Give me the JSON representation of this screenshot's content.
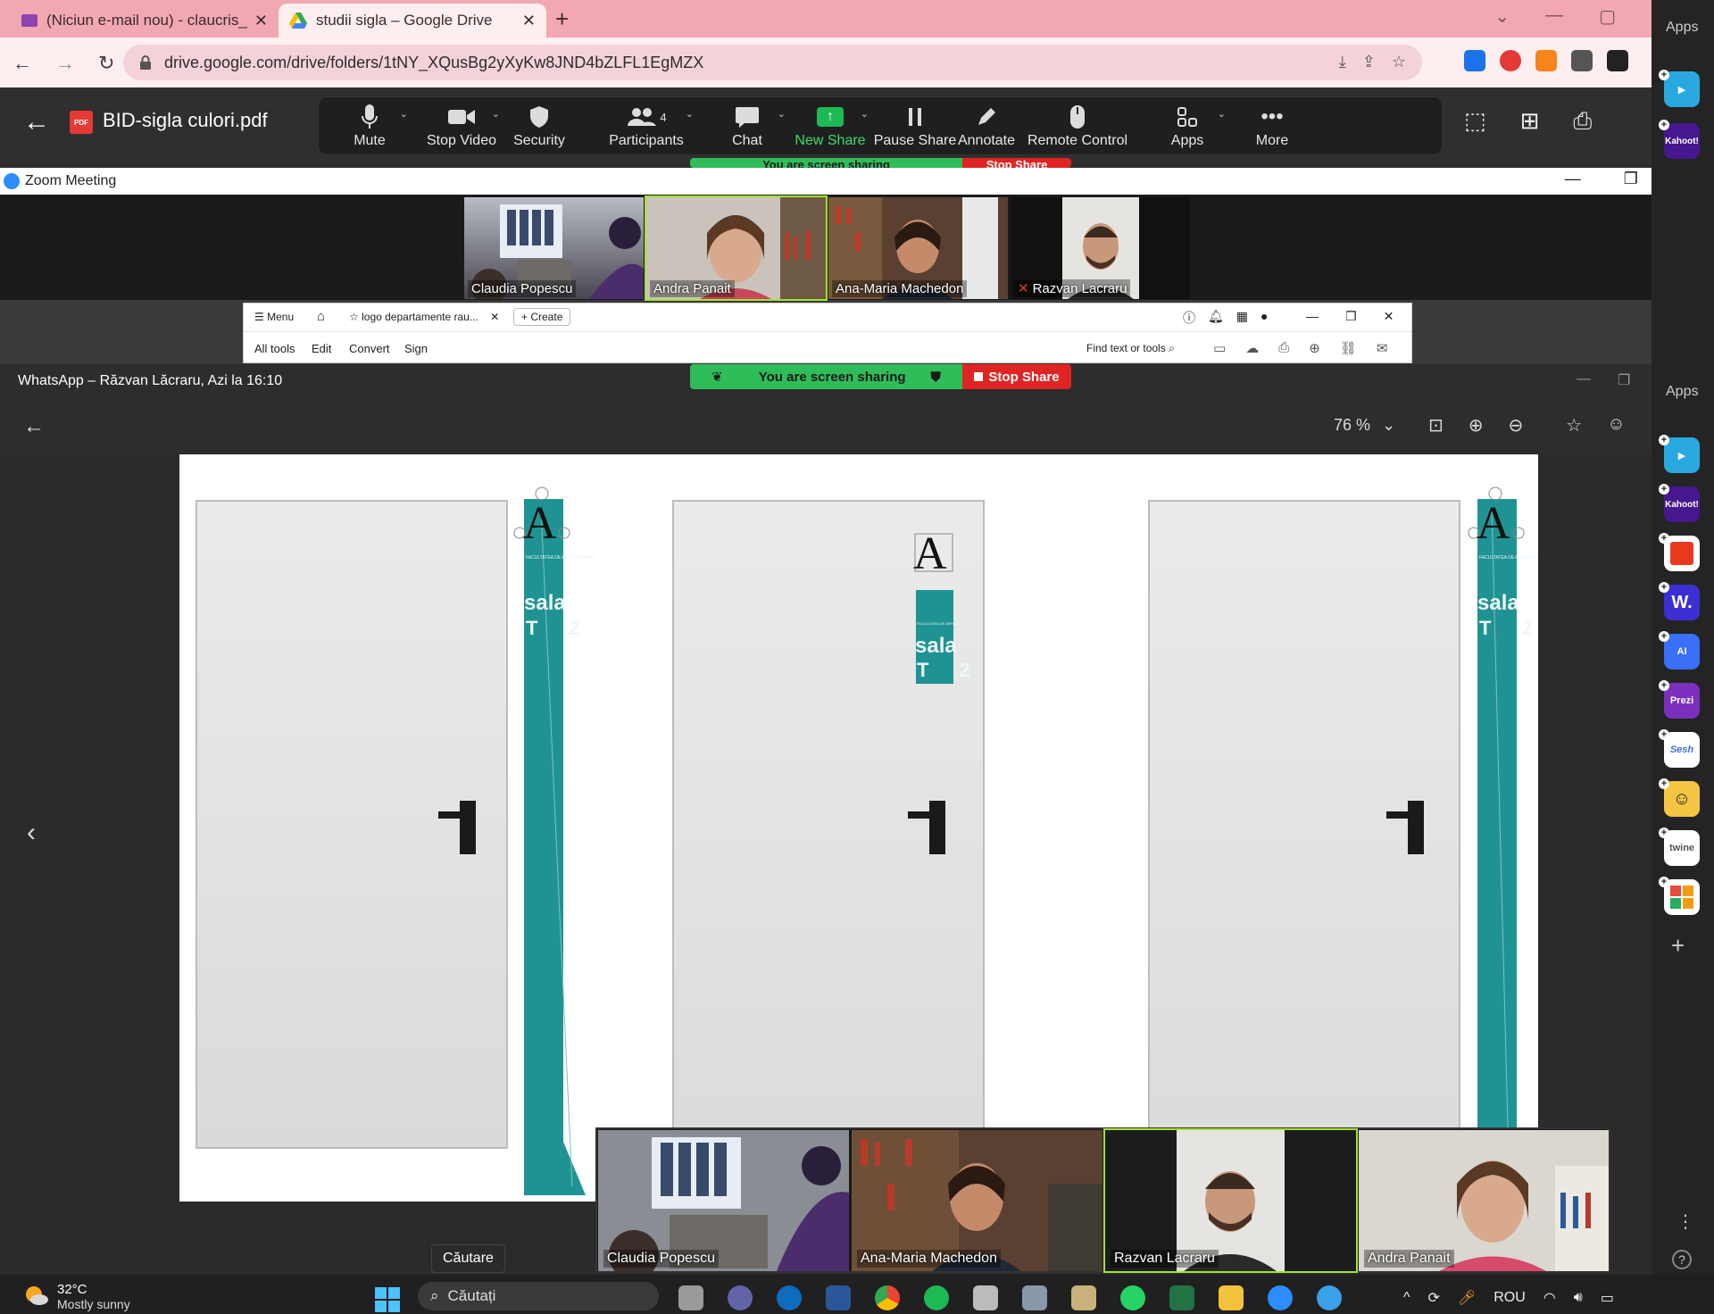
{
  "browser": {
    "tabs": [
      {
        "title": "(Niciun e-mail nou) - claucris_po",
        "icon": "gmail-icon"
      },
      {
        "title": "studii sigla – Google Drive",
        "icon": "google-drive-icon",
        "active": true
      }
    ],
    "new_tab": "+",
    "url": "drive.google.com/drive/folders/1tNY_XQusBg2yXyKw8JND4bZLFL1EgMZX"
  },
  "drive": {
    "file_title": "BID-sigla culori.pdf",
    "badge": "PDF"
  },
  "zoom_toolbar": {
    "buttons": [
      {
        "label": "Mute",
        "icon": "microphone-icon"
      },
      {
        "label": "Stop Video",
        "icon": "video-camera-icon"
      },
      {
        "label": "Security",
        "icon": "shield-icon"
      },
      {
        "label": "Participants",
        "icon": "participants-icon",
        "count": "4"
      },
      {
        "label": "Chat",
        "icon": "chat-icon"
      },
      {
        "label": "New Share",
        "icon": "share-arrow-icon"
      },
      {
        "label": "Pause Share",
        "icon": "pause-icon"
      },
      {
        "label": "Annotate",
        "icon": "pencil-icon"
      },
      {
        "label": "Remote Control",
        "icon": "mouse-icon"
      },
      {
        "label": "Apps",
        "icon": "apps-icon"
      },
      {
        "label": "More",
        "icon": "more-dots-icon"
      }
    ]
  },
  "zoom_meeting": {
    "window_title": "Zoom Meeting",
    "gallery": [
      {
        "name": "Claudia Popescu"
      },
      {
        "name": "Andra Panait"
      },
      {
        "name": "Ana-Maria Machedon"
      },
      {
        "name": "Razvan Lacraru"
      }
    ],
    "bottom_strip": [
      {
        "name": "Claudia Popescu"
      },
      {
        "name": "Ana-Maria Machedon"
      },
      {
        "name": "Razvan Lacraru"
      },
      {
        "name": "Andra Panait"
      }
    ]
  },
  "acrobat": {
    "menu": "Menu",
    "tab_title": "logo departamente rau...",
    "create": "Create",
    "tools": [
      "All tools",
      "Edit",
      "Convert",
      "Sign"
    ],
    "find": "Find text or tools"
  },
  "share_banner": {
    "status": "You are screen sharing",
    "stop": "Stop Share"
  },
  "whatsapp": {
    "title": "WhatsApp – Răzvan Lăcraru, Azi la 16:10",
    "zoom": "76 %"
  },
  "sign": {
    "text_line1": "sala",
    "text_line2": "T 2",
    "letter": "A",
    "institution": "FACULTATEA DE ARHITECTURĂ",
    "accent_color": "#1f9393"
  },
  "sidebar": {
    "label": "Apps",
    "apps": [
      {
        "name": "Wooflash",
        "icon": "flag-icon",
        "color": "#29a8e0"
      },
      {
        "name": "Kahoot!",
        "label": "Kahoot!",
        "color": "#46178f"
      },
      {
        "name": "Slido",
        "color": "#e8391e"
      },
      {
        "name": "Wordwall",
        "label": "W.",
        "color": "#3b2fd4"
      },
      {
        "name": "AI",
        "label": "AI",
        "color": "#3a6ff7"
      },
      {
        "name": "Prezi",
        "label": "Prezi",
        "color": "#7b2fbf"
      },
      {
        "name": "Sesh",
        "label": "Sesh",
        "color": "#ffffff"
      },
      {
        "name": "Emoji",
        "color": "#f4c542"
      },
      {
        "name": "Twine",
        "label": "twine",
        "color": "#ffffff"
      },
      {
        "name": "Blocks",
        "color": "#ffffff"
      }
    ]
  },
  "taskbar": {
    "temperature": "32°C",
    "weather": "Mostly sunny",
    "search_placeholder": "Căutați",
    "tooltip": "Căutare",
    "language": "ROU"
  }
}
